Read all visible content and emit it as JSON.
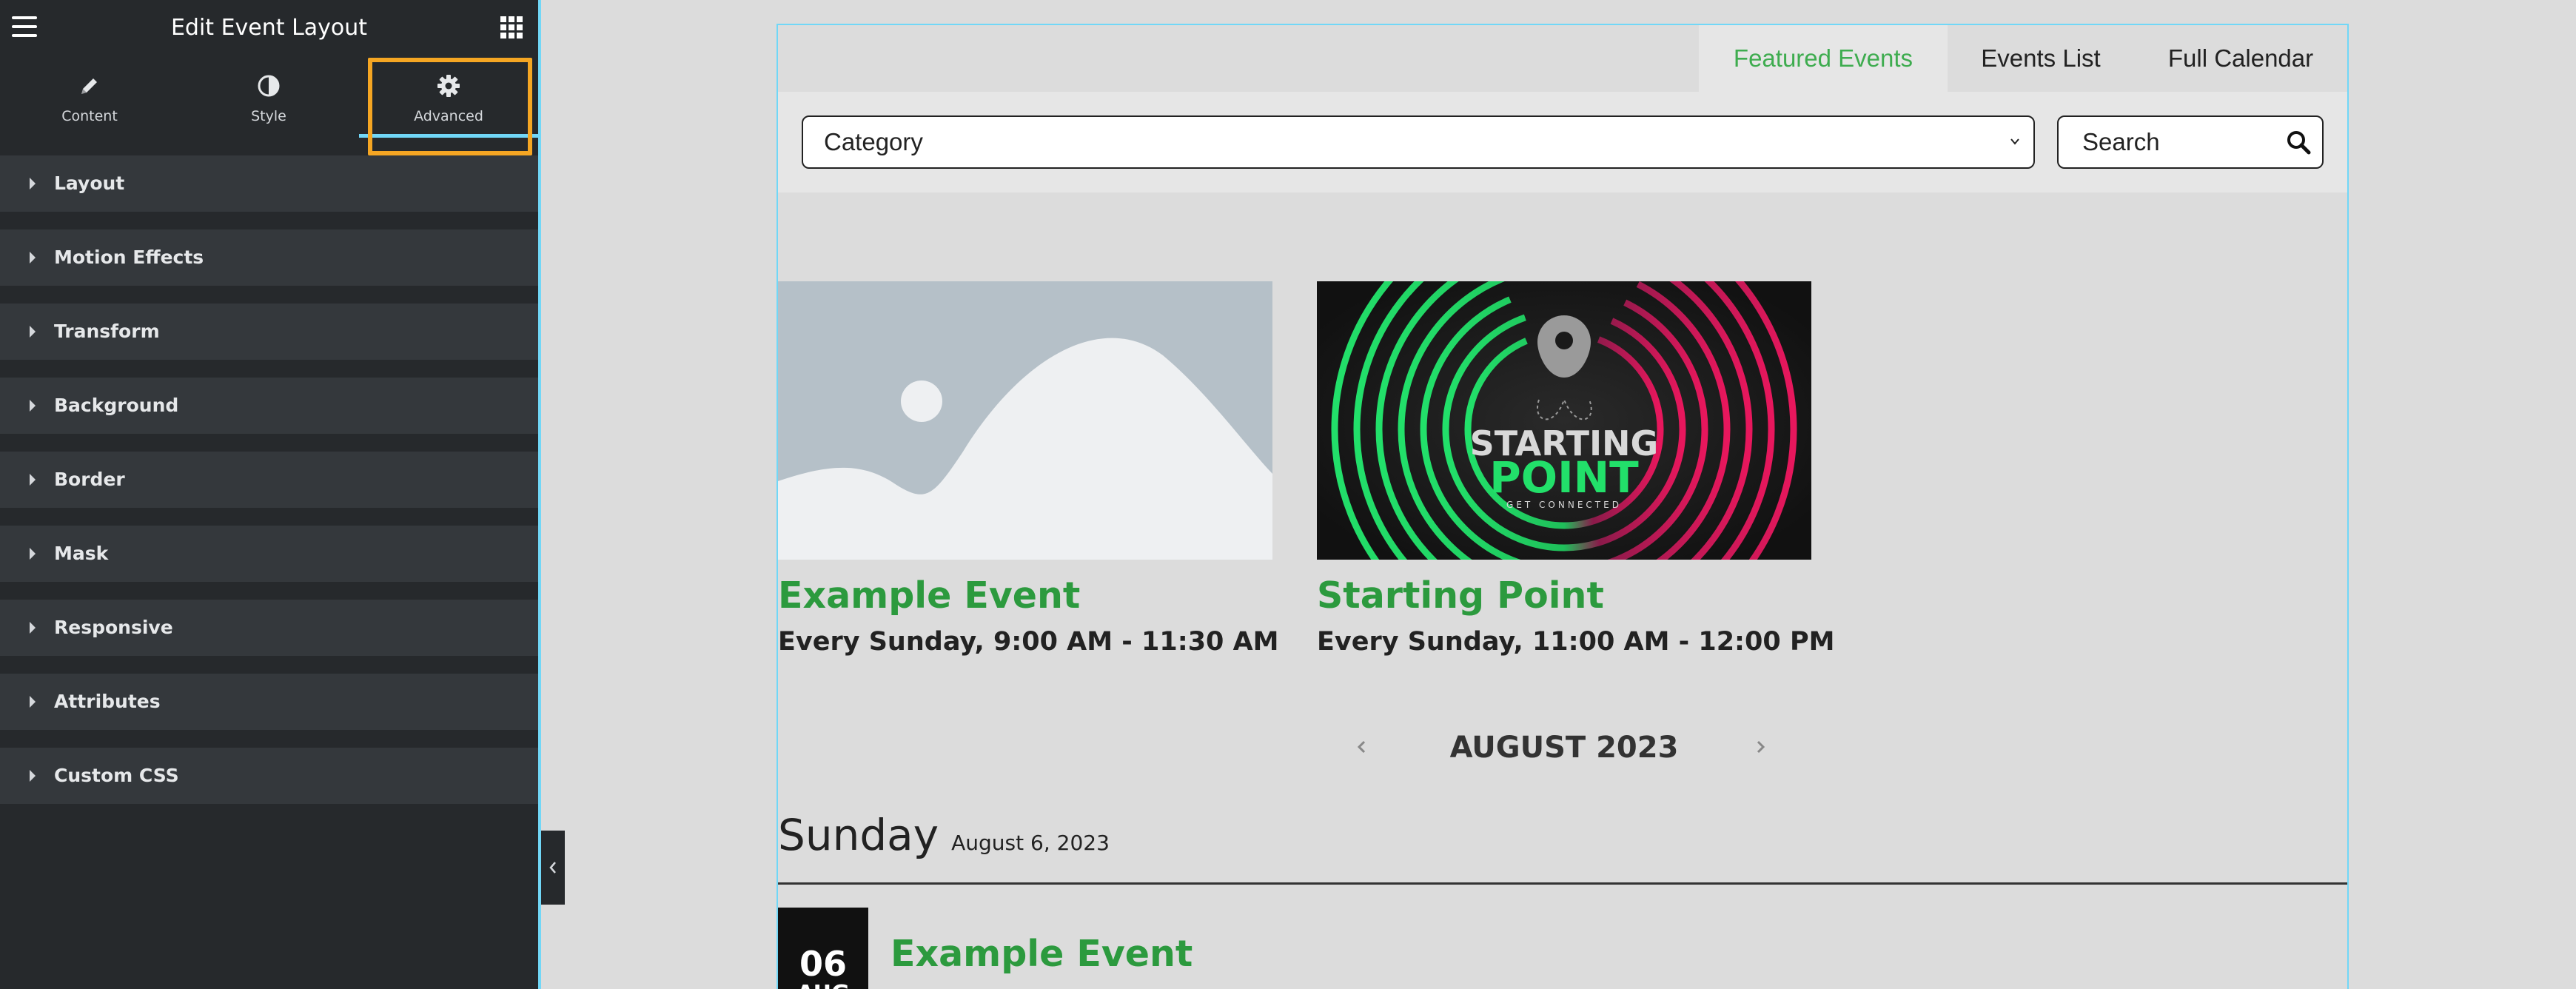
{
  "editor": {
    "title": "Edit Event Layout",
    "tabs": [
      {
        "label": "Content",
        "icon": "pencil-icon"
      },
      {
        "label": "Style",
        "icon": "contrast-icon"
      },
      {
        "label": "Advanced",
        "icon": "gear-icon"
      }
    ],
    "active_tab": "Advanced",
    "sections": [
      "Layout",
      "Motion Effects",
      "Transform",
      "Background",
      "Border",
      "Mask",
      "Responsive",
      "Attributes",
      "Custom CSS"
    ]
  },
  "preview": {
    "tabs": [
      "Featured Events",
      "Events List",
      "Full Calendar"
    ],
    "active_tab": "Featured Events",
    "filters": {
      "category_value": "Category",
      "search_placeholder": "Search"
    },
    "featured": [
      {
        "title": "Example Event",
        "time": "Every Sunday, 9:00 AM - 11:30 AM",
        "image": "placeholder-image"
      },
      {
        "title": "Starting Point",
        "time": "Every Sunday, 11:00 AM - 12:00 PM",
        "image": "starting-point-graphic",
        "image_text": {
          "line1": "STARTING",
          "line2": "POINT",
          "line3": "GET CONNECTED"
        }
      }
    ],
    "month": "AUGUST 2023",
    "day": {
      "name": "Sunday",
      "date": "August 6, 2023"
    },
    "list_event": {
      "day": "06",
      "month": "AUG",
      "title": "Example Event"
    }
  },
  "colors": {
    "accent_green": "#2c9a3e",
    "active_tab_green": "#3eac4f",
    "panel_bg": "#26292c",
    "section_bg": "#34383c",
    "highlight_orange": "#f5a623",
    "editor_blue": "#71d7f7"
  }
}
